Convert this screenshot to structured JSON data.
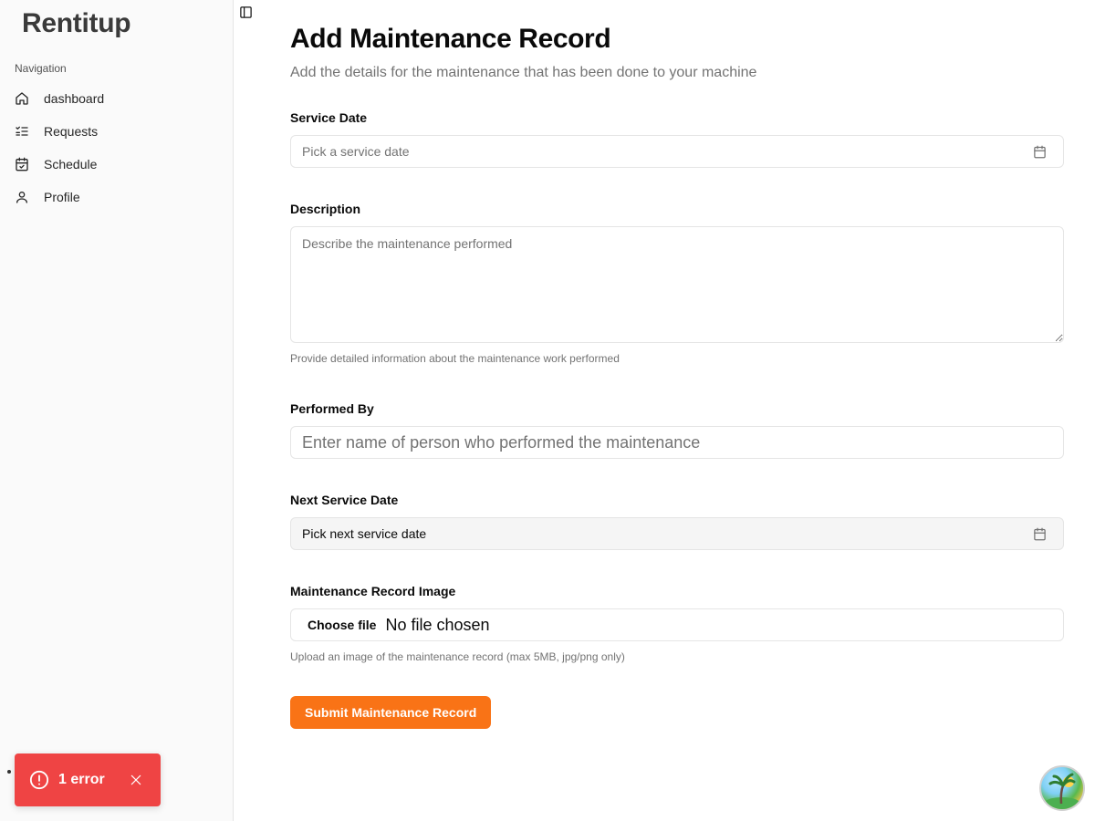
{
  "app": {
    "brand": "Rentitup"
  },
  "sidebar": {
    "group_label": "Navigation",
    "items": [
      {
        "label": "dashboard",
        "icon": "home-icon"
      },
      {
        "label": "Requests",
        "icon": "list-checks-icon"
      },
      {
        "label": "Schedule",
        "icon": "calendar-check-icon"
      },
      {
        "label": "Profile",
        "icon": "user-icon"
      }
    ]
  },
  "page": {
    "title": "Add Maintenance Record",
    "subtitle": "Add the details for the maintenance that has been done to your machine"
  },
  "form": {
    "service_date": {
      "label": "Service Date",
      "placeholder": "Pick a service date"
    },
    "description": {
      "label": "Description",
      "placeholder": "Describe the maintenance performed",
      "helper": "Provide detailed information about the maintenance work performed"
    },
    "performed_by": {
      "label": "Performed By",
      "placeholder": "Enter name of person who performed the maintenance"
    },
    "next_service_date": {
      "label": "Next Service Date",
      "value": "Pick next service date"
    },
    "image": {
      "label": "Maintenance Record Image",
      "button": "Choose file",
      "status": "No file chosen",
      "helper": "Upload an image of the maintenance record (max 5MB, jpg/png only)"
    },
    "submit_label": "Submit Maintenance Record"
  },
  "toast": {
    "text": "1 error",
    "color": "#ef4444"
  },
  "colors": {
    "accent": "#f97316",
    "sidebar_bg": "#fafafa",
    "muted_text": "#737373"
  }
}
